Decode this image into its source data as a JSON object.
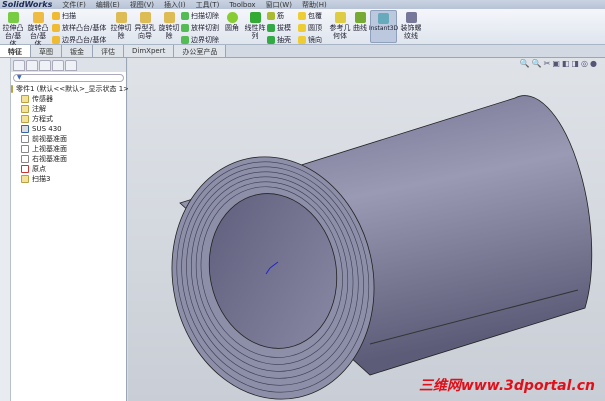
{
  "app": {
    "logo": "SolidWorks"
  },
  "menu": [
    "文件(F)",
    "编辑(E)",
    "视图(V)",
    "插入(I)",
    "工具(T)",
    "Toolbox",
    "窗口(W)",
    "帮助(H)"
  ],
  "ribbon": {
    "extrude_boss": "拉伸凸台/基体",
    "revolve_boss": "旋转凸台/基体",
    "sweep": "扫描",
    "loft": "放样凸台/基体",
    "boundary": "边界凸台/基体",
    "extrude_cut": "拉伸切除",
    "hole_wizard": "异型孔向导",
    "revolve_cut": "旋转切除",
    "sweep_cut": "扫描切除",
    "loft_cut": "放样切割",
    "boundary_cut": "边界切除",
    "fillet": "圆角",
    "linear_pattern": "线性阵列",
    "rib": "筋",
    "draft": "拔模",
    "shell": "抽壳",
    "wrap": "包覆",
    "intersect": "圆顶",
    "mirror": "镜向",
    "ref_geometry": "参考几何体",
    "curves": "曲线",
    "instant3d": "Instant3D",
    "cosmetic_thread": "装饰螺纹线"
  },
  "tabs": [
    "特征",
    "草图",
    "钣金",
    "评估",
    "DimXpert",
    "办公室产品"
  ],
  "tree": {
    "root": "零件1 (默认<<默认>_显示状态 1>)",
    "items": [
      "传感器",
      "注解",
      "方程式",
      "SUS 430",
      "前视基准面",
      "上视基准面",
      "右视基准面",
      "原点",
      "扫描3"
    ]
  },
  "watermark": "三维网www.3dportal.cn"
}
